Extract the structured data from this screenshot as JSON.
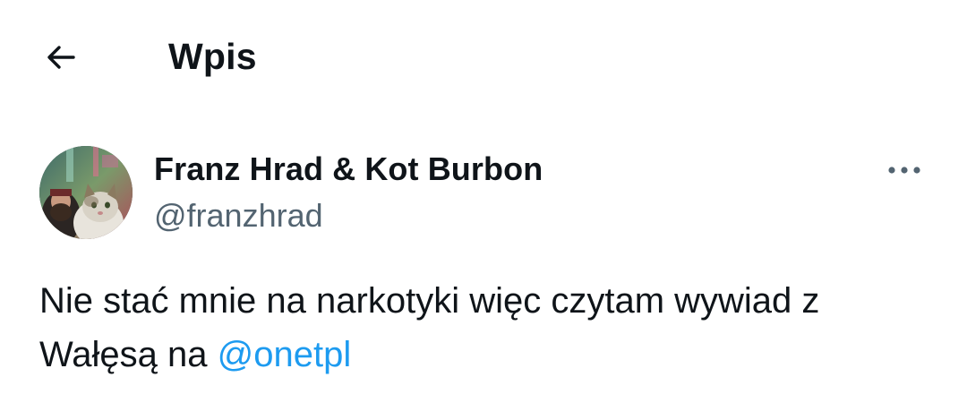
{
  "header": {
    "back_icon": "arrow-left-icon",
    "title": "Wpis"
  },
  "tweet": {
    "author": {
      "display_name": "Franz Hrad & Kot Burbon",
      "handle": "@franzhrad",
      "avatar_icon": "avatar-photo"
    },
    "more_icon": "more-horizontal-icon",
    "text_line1": "Nie stać mnie na narkotyki więc czytam wywiad z",
    "text_line2_prefix": "Wałęsą na ",
    "mention": "@onetpl"
  },
  "colors": {
    "text": "#0f1419",
    "secondary": "#536471",
    "link": "#1d9bf0",
    "background": "#ffffff"
  }
}
